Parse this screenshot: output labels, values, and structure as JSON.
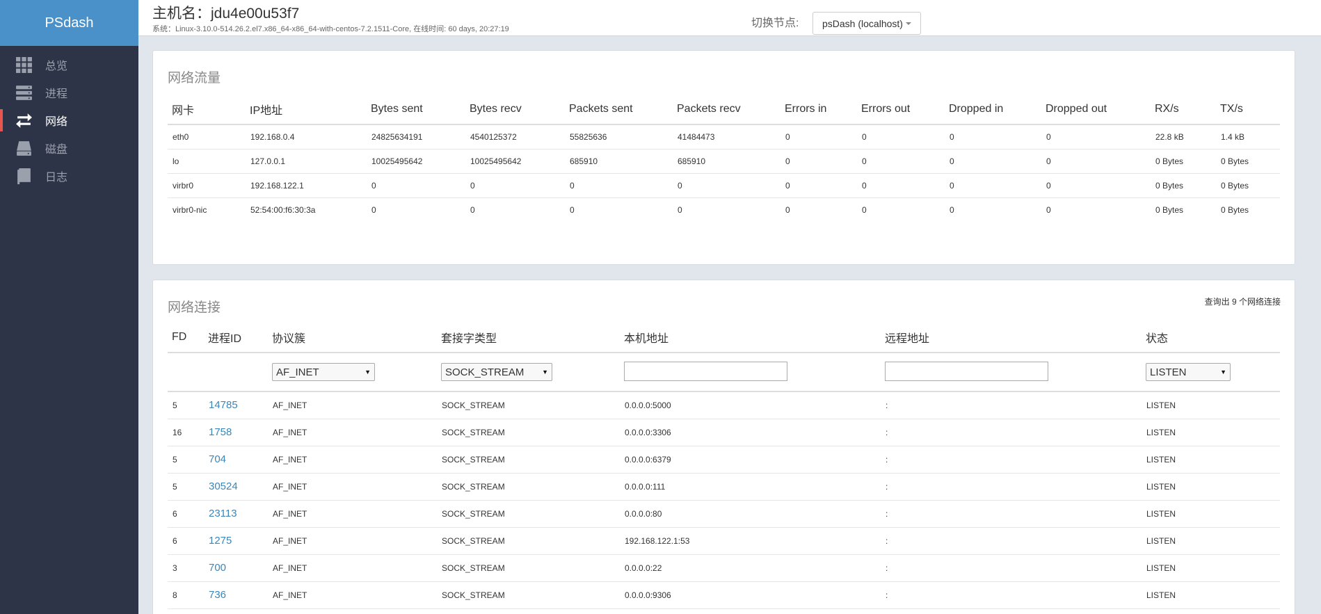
{
  "sidebar": {
    "brand": "PSdash",
    "items": [
      {
        "label": "总览",
        "icon": "grid-icon"
      },
      {
        "label": "进程",
        "icon": "server-icon"
      },
      {
        "label": "网络",
        "icon": "exchange-icon",
        "active": true
      },
      {
        "label": "磁盘",
        "icon": "hard-drive-icon"
      },
      {
        "label": "日志",
        "icon": "book-icon"
      }
    ]
  },
  "header": {
    "host_title": "主机名：jdu4e00u53f7",
    "system_info": "系统：Linux-3.10.0-514.26.2.el7.x86_64-x86_64-with-centos-7.2.1511-Core, 在线时间: 60 days, 20:27:19",
    "node_label": "切换节点:",
    "node_value": "psDash (localhost)"
  },
  "traffic": {
    "title": "网络流量",
    "columns": [
      "网卡",
      "IP地址",
      "Bytes sent",
      "Bytes recv",
      "Packets sent",
      "Packets recv",
      "Errors in",
      "Errors out",
      "Dropped in",
      "Dropped out",
      "RX/s",
      "TX/s"
    ],
    "rows": [
      [
        "eth0",
        "192.168.0.4",
        "24825634191",
        "4540125372",
        "55825636",
        "41484473",
        "0",
        "0",
        "0",
        "0",
        "22.8 kB",
        "1.4 kB"
      ],
      [
        "lo",
        "127.0.0.1",
        "10025495642",
        "10025495642",
        "685910",
        "685910",
        "0",
        "0",
        "0",
        "0",
        "0 Bytes",
        "0 Bytes"
      ],
      [
        "virbr0",
        "192.168.122.1",
        "0",
        "0",
        "0",
        "0",
        "0",
        "0",
        "0",
        "0",
        "0 Bytes",
        "0 Bytes"
      ],
      [
        "virbr0-nic",
        "52:54:00:f6:30:3a",
        "0",
        "0",
        "0",
        "0",
        "0",
        "0",
        "0",
        "0",
        "0 Bytes",
        "0 Bytes"
      ]
    ]
  },
  "connections": {
    "title": "网络连接",
    "count_text": "查询出 9 个网络连接",
    "columns": [
      "FD",
      "进程ID",
      "协议簇",
      "套接字类型",
      "本机地址",
      "远程地址",
      "状态"
    ],
    "filters": {
      "family": "AF_INET",
      "type": "SOCK_STREAM",
      "local": "",
      "remote": "",
      "state": "LISTEN"
    },
    "rows": [
      [
        "5",
        "14785",
        "AF_INET",
        "SOCK_STREAM",
        "0.0.0.0:5000",
        ":",
        "LISTEN"
      ],
      [
        "16",
        "1758",
        "AF_INET",
        "SOCK_STREAM",
        "0.0.0.0:3306",
        ":",
        "LISTEN"
      ],
      [
        "5",
        "704",
        "AF_INET",
        "SOCK_STREAM",
        "0.0.0.0:6379",
        ":",
        "LISTEN"
      ],
      [
        "5",
        "30524",
        "AF_INET",
        "SOCK_STREAM",
        "0.0.0.0:111",
        ":",
        "LISTEN"
      ],
      [
        "6",
        "23113",
        "AF_INET",
        "SOCK_STREAM",
        "0.0.0.0:80",
        ":",
        "LISTEN"
      ],
      [
        "6",
        "1275",
        "AF_INET",
        "SOCK_STREAM",
        "192.168.122.1:53",
        ":",
        "LISTEN"
      ],
      [
        "3",
        "700",
        "AF_INET",
        "SOCK_STREAM",
        "0.0.0.0:22",
        ":",
        "LISTEN"
      ],
      [
        "8",
        "736",
        "AF_INET",
        "SOCK_STREAM",
        "0.0.0.0:9306",
        ":",
        "LISTEN"
      ]
    ]
  },
  "colors": {
    "sidebar_bg": "#2e3447",
    "brand_bg": "#4a90c9",
    "active_marker": "#e8554e",
    "link": "#3a86b7"
  }
}
